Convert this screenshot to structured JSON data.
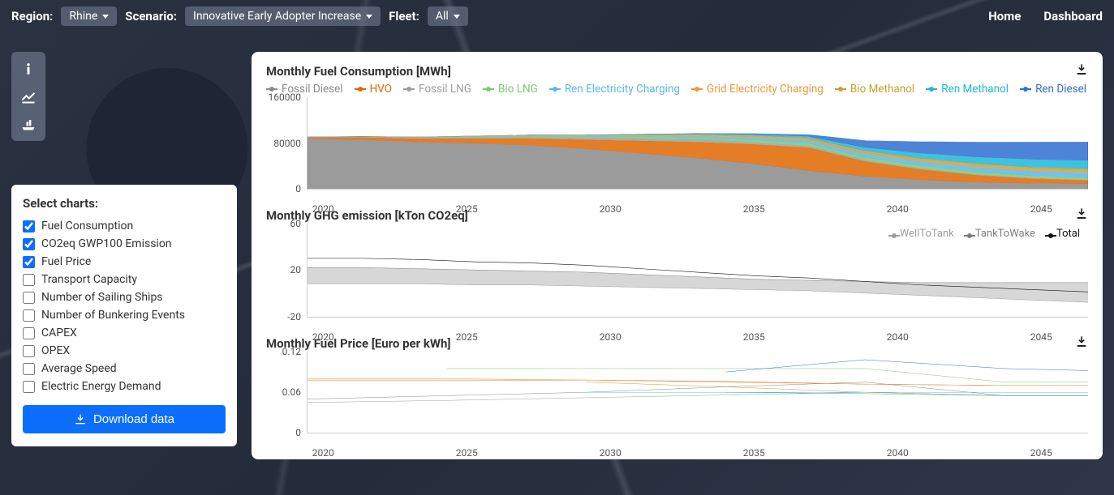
{
  "topbar": {
    "region_label": "Region:",
    "region_value": "Rhine",
    "scenario_label": "Scenario:",
    "scenario_value": "Innovative Early Adopter Increase",
    "fleet_label": "Fleet:",
    "fleet_value": "All",
    "nav_home": "Home",
    "nav_dashboard": "Dashboard"
  },
  "panel": {
    "title": "Select charts:",
    "items": [
      {
        "label": "Fuel Consumption",
        "checked": true
      },
      {
        "label": "CO2eq GWP100 Emission",
        "checked": true
      },
      {
        "label": "Fuel Price",
        "checked": true
      },
      {
        "label": "Transport Capacity",
        "checked": false
      },
      {
        "label": "Number of Sailing Ships",
        "checked": false
      },
      {
        "label": "Number of Bunkering Events",
        "checked": false
      },
      {
        "label": "CAPEX",
        "checked": false
      },
      {
        "label": "OPEX",
        "checked": false
      },
      {
        "label": "Average Speed",
        "checked": false
      },
      {
        "label": "Electric Energy Demand",
        "checked": false
      }
    ],
    "download_label": "Download data"
  },
  "charts": {
    "fuel": {
      "title": "Monthly Fuel Consumption [MWh]",
      "legend": [
        {
          "name": "Fossil Diesel",
          "color": "#8a8a8a"
        },
        {
          "name": "HVO",
          "color": "#e06500"
        },
        {
          "name": "Fossil LNG",
          "color": "#9e9e9e"
        },
        {
          "name": "Bio LNG",
          "color": "#7bc96f"
        },
        {
          "name": "Ren Electricity Charging",
          "color": "#5bb7e6"
        },
        {
          "name": "Grid Electricity Charging",
          "color": "#e99a3f"
        },
        {
          "name": "Bio Methanol",
          "color": "#c9a227"
        },
        {
          "name": "Ren Methanol",
          "color": "#1fb6d9"
        },
        {
          "name": "Ren Diesel",
          "color": "#2f6fd0"
        }
      ],
      "yticks": [
        {
          "v": 0,
          "p": 100
        },
        {
          "v": 80000,
          "p": 50
        },
        {
          "v": 160000,
          "p": 0
        }
      ],
      "xticks": [
        "2020",
        "2025",
        "2030",
        "2035",
        "2040",
        "2045"
      ]
    },
    "ghg": {
      "title": "Monthly GHG emission [kTon CO2eq]",
      "legend": [
        {
          "name": "WellToTank",
          "color": "#9e9e9e"
        },
        {
          "name": "TankToWake",
          "color": "#7d7d7d"
        },
        {
          "name": "Total",
          "color": "#111111"
        }
      ],
      "yticks": [
        {
          "v": -20,
          "p": 100
        },
        {
          "v": 20,
          "p": 50
        },
        {
          "v": 60,
          "p": 0
        }
      ],
      "xticks": [
        "2020",
        "2025",
        "2030",
        "2035",
        "2040",
        "2045"
      ]
    },
    "price": {
      "title": "Monthly Fuel Price [Euro per kWh]",
      "yticks": [
        {
          "v": 0,
          "p": 100
        },
        {
          "v": 0.06,
          "p": 50
        },
        {
          "v": 0.12,
          "p": 0
        }
      ],
      "xticks": [
        "2020",
        "2025",
        "2030",
        "2035",
        "2040",
        "2045"
      ]
    }
  },
  "chart_data": [
    {
      "type": "area",
      "title": "Monthly Fuel Consumption [MWh]",
      "xlabel": "",
      "ylabel": "MWh",
      "x_range": [
        2020,
        2048
      ],
      "ylim": [
        0,
        160000
      ],
      "x": [
        2020,
        2022,
        2024,
        2026,
        2028,
        2030,
        2032,
        2034,
        2036,
        2038,
        2040,
        2042,
        2044,
        2046,
        2048
      ],
      "series": [
        {
          "name": "Fossil Diesel",
          "color": "#8a8a8a",
          "values": [
            88000,
            86000,
            82000,
            80000,
            76000,
            70000,
            62000,
            54000,
            44000,
            32000,
            22000,
            16000,
            12000,
            10000,
            9000
          ]
        },
        {
          "name": "HVO",
          "color": "#e06500",
          "values": [
            2000,
            4000,
            6000,
            8000,
            12000,
            16000,
            22000,
            28000,
            34000,
            40000,
            26000,
            18000,
            12000,
            8000,
            6000
          ]
        },
        {
          "name": "Fossil LNG",
          "color": "#9e9e9e",
          "values": [
            1000,
            1500,
            2000,
            2500,
            3000,
            3500,
            4000,
            4000,
            3500,
            3000,
            2500,
            2000,
            1500,
            1200,
            1000
          ]
        },
        {
          "name": "Bio LNG",
          "color": "#7bc96f",
          "values": [
            0,
            0,
            500,
            1000,
            1500,
            2000,
            3000,
            3500,
            4000,
            4500,
            5000,
            5000,
            4500,
            4000,
            3500
          ]
        },
        {
          "name": "Ren Electricity Charging",
          "color": "#5bb7e6",
          "values": [
            0,
            0,
            0,
            500,
            1000,
            1500,
            2000,
            3000,
            4000,
            5000,
            6000,
            7000,
            8000,
            8500,
            9000
          ]
        },
        {
          "name": "Grid Electricity Charging",
          "color": "#e99a3f",
          "values": [
            0,
            200,
            400,
            600,
            800,
            1000,
            1200,
            1400,
            1600,
            1800,
            2000,
            2000,
            2000,
            2000,
            2000
          ]
        },
        {
          "name": "Bio Methanol",
          "color": "#c9a227",
          "values": [
            0,
            0,
            0,
            0,
            0,
            500,
            1000,
            1500,
            2000,
            2500,
            3000,
            3500,
            4000,
            4200,
            4500
          ]
        },
        {
          "name": "Ren Methanol",
          "color": "#1fb6d9",
          "values": [
            0,
            0,
            0,
            0,
            0,
            0,
            500,
            1000,
            2000,
            3000,
            6000,
            9000,
            12000,
            14000,
            15000
          ]
        },
        {
          "name": "Ren Diesel",
          "color": "#2f6fd0",
          "values": [
            0,
            0,
            0,
            0,
            0,
            0,
            0,
            500,
            1500,
            3000,
            12000,
            20000,
            26000,
            30000,
            32000
          ]
        }
      ]
    },
    {
      "type": "line",
      "title": "Monthly GHG emission [kTon CO2eq]",
      "xlabel": "",
      "ylabel": "kTon CO2eq",
      "x_range": [
        2020,
        2048
      ],
      "ylim": [
        -20,
        60
      ],
      "x": [
        2020,
        2022,
        2024,
        2026,
        2028,
        2030,
        2032,
        2034,
        2036,
        2038,
        2040,
        2042,
        2044,
        2046,
        2048
      ],
      "series": [
        {
          "name": "WellToTank",
          "color": "#9e9e9e",
          "values": [
            8,
            8,
            8,
            7,
            7,
            6,
            5,
            4,
            3,
            2,
            0,
            -2,
            -4,
            -6,
            -8
          ]
        },
        {
          "name": "TankToWake",
          "color": "#7d7d7d",
          "values": [
            22,
            22,
            21,
            20,
            19,
            18,
            16,
            14,
            12,
            11,
            10,
            9,
            9,
            9,
            9
          ]
        },
        {
          "name": "Total",
          "color": "#111111",
          "values": [
            30,
            30,
            29,
            27,
            26,
            24,
            21,
            18,
            15,
            13,
            10,
            7,
            5,
            3,
            1
          ]
        }
      ]
    },
    {
      "type": "line",
      "title": "Monthly Fuel Price [Euro per kWh]",
      "xlabel": "",
      "ylabel": "Euro/kWh",
      "x_range": [
        2020,
        2048
      ],
      "ylim": [
        0,
        0.12
      ],
      "x": [
        2020,
        2025,
        2030,
        2035,
        2040,
        2045,
        2048
      ],
      "series": [
        {
          "name": "Fossil Diesel",
          "color": "#8a8a8a",
          "values": [
            0.05,
            0.055,
            0.06,
            0.068,
            0.075,
            0.055,
            0.055
          ]
        },
        {
          "name": "HVO",
          "color": "#e06500",
          "values": [
            0.078,
            0.078,
            0.078,
            0.076,
            0.072,
            0.07,
            0.07
          ]
        },
        {
          "name": "Fossil LNG",
          "color": "#9e9e9e",
          "values": [
            0.045,
            0.048,
            0.052,
            0.056,
            0.06,
            0.055,
            0.055
          ]
        },
        {
          "name": "Bio LNG",
          "color": "#7bc96f",
          "values": [
            null,
            0.095,
            0.095,
            0.095,
            0.095,
            0.075,
            0.075
          ]
        },
        {
          "name": "Ren Electricity Charging",
          "color": "#5bb7e6",
          "values": [
            null,
            null,
            0.06,
            0.06,
            0.06,
            0.06,
            0.06
          ]
        },
        {
          "name": "Grid Electricity Charging",
          "color": "#e99a3f",
          "values": [
            0.08,
            0.08,
            0.078,
            0.075,
            0.072,
            0.07,
            0.07
          ]
        },
        {
          "name": "Bio Methanol",
          "color": "#c9a227",
          "values": [
            null,
            null,
            0.075,
            0.068,
            0.06,
            0.055,
            0.055
          ]
        },
        {
          "name": "Ren Methanol",
          "color": "#1fb6d9",
          "values": [
            null,
            null,
            null,
            0.06,
            0.058,
            0.055,
            0.055
          ]
        },
        {
          "name": "Ren Diesel",
          "color": "#2f6fd0",
          "values": [
            null,
            null,
            null,
            0.09,
            0.108,
            0.095,
            0.092
          ]
        }
      ]
    }
  ]
}
